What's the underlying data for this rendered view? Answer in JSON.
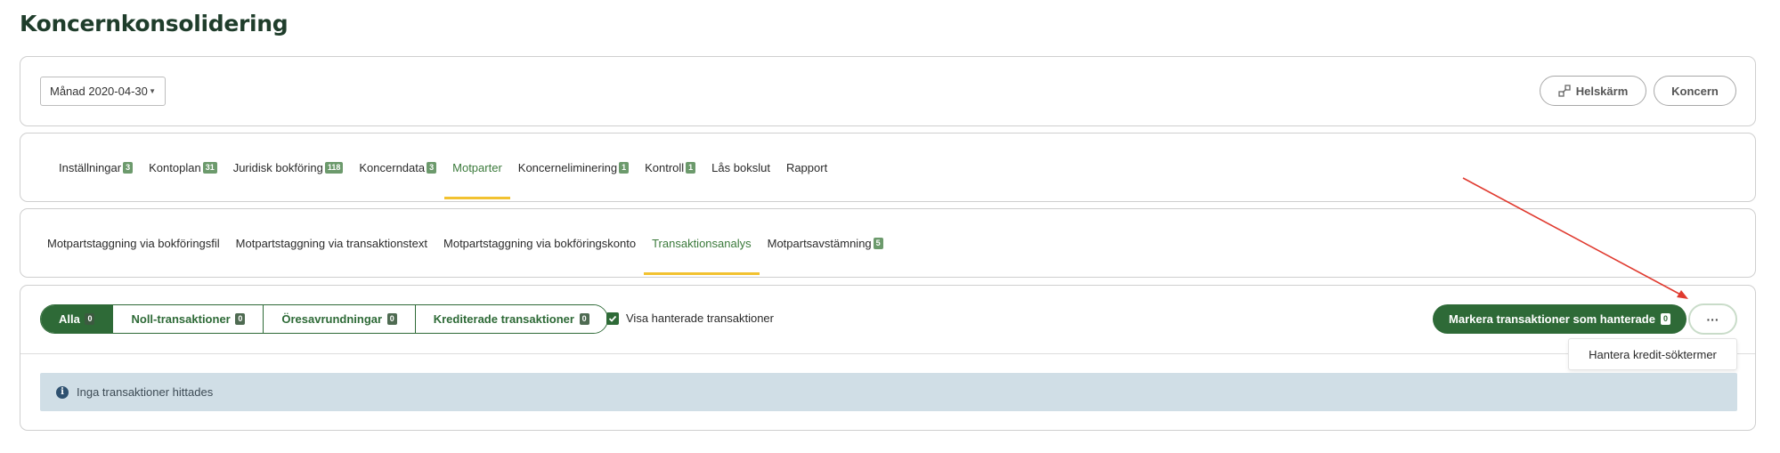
{
  "page": {
    "title": "Koncernkonsolidering"
  },
  "toolbar": {
    "period_label": "Månad 2020-04-30",
    "fullscreen_label": "Helskärm",
    "koncern_label": "Koncern"
  },
  "main_tabs": [
    {
      "label": "Inställningar",
      "badge": "3"
    },
    {
      "label": "Kontoplan",
      "badge": "31"
    },
    {
      "label": "Juridisk bokföring",
      "badge": "118"
    },
    {
      "label": "Koncerndata",
      "badge": "3"
    },
    {
      "label": "Motparter",
      "badge": "",
      "active": true
    },
    {
      "label": "Koncerneliminering",
      "badge": "1"
    },
    {
      "label": "Kontroll",
      "badge": "1"
    },
    {
      "label": "Lås bokslut",
      "badge": ""
    },
    {
      "label": "Rapport",
      "badge": ""
    }
  ],
  "sub_tabs": [
    {
      "label": "Motpartstaggning via bokföringsfil",
      "badge": ""
    },
    {
      "label": "Motpartstaggning via transaktionstext",
      "badge": ""
    },
    {
      "label": "Motpartstaggning via bokföringskonto",
      "badge": ""
    },
    {
      "label": "Transaktionsanalys",
      "badge": "",
      "active": true
    },
    {
      "label": "Motpartsavstämning",
      "badge": "5"
    }
  ],
  "filters": [
    {
      "label": "Alla",
      "badge": "0",
      "active": true
    },
    {
      "label": "Noll-transaktioner",
      "badge": "0"
    },
    {
      "label": "Öresavrundningar",
      "badge": "0"
    },
    {
      "label": "Krediterade transaktioner",
      "badge": "0"
    }
  ],
  "show_handled": {
    "label": "Visa hanterade transaktioner",
    "checked": true
  },
  "mark_button": {
    "label": "Markera transaktioner som hanterade",
    "badge": "0"
  },
  "more_button": {
    "label": "···"
  },
  "dropdown": {
    "item": "Hantera kredit-söktermer"
  },
  "info": {
    "icon": "i",
    "message": "Inga transaktioner hittades"
  },
  "colors": {
    "primary": "#2e6a37",
    "accent_underline": "#f2c230",
    "info_bg": "#d0dee6",
    "annotation_arrow": "#e03a2f"
  }
}
